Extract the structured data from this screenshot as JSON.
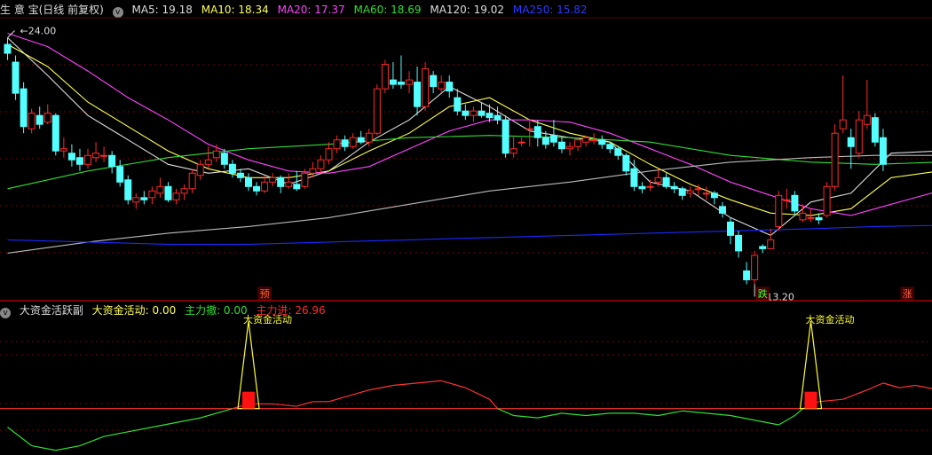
{
  "main_header": {
    "title": "生 意 宝(日线 前复权)",
    "ma5": "MA5: 19.18",
    "ma10": "MA10: 18.34",
    "ma20": "MA20: 17.37",
    "ma60": "MA60: 18.69",
    "ma120": "MA120: 19.02",
    "ma250": "MA250: 15.82"
  },
  "sub_header": {
    "title": "大资金活跃副",
    "active": "大资金活动: 0.00",
    "outflow": "主力撤: 0.00",
    "inflow": "主力进: 26.96"
  },
  "colors": {
    "up": "#ff2a2a",
    "down": "#54ffff",
    "ma5": "#dddddd",
    "ma10": "#ffff55",
    "ma20": "#ff44ff",
    "ma60": "#33dd33",
    "ma120": "#bbbbbb",
    "ma250": "#1a2aff",
    "grid": "#7a0000"
  },
  "chart_data": [
    {
      "type": "candlestick",
      "ylim": [
        12.5,
        25.2
      ],
      "price_labels": {
        "high": "24.00",
        "low": "13.20"
      },
      "candles": [
        [
          24.0,
          23.6,
          24.3,
          23.3
        ],
        [
          23.2,
          21.8,
          23.5,
          21.5
        ],
        [
          22.0,
          20.3,
          22.3,
          20.0
        ],
        [
          20.2,
          20.9,
          21.1,
          20.0
        ],
        [
          20.8,
          20.4,
          21.2,
          20.2
        ],
        [
          20.5,
          20.9,
          21.3,
          20.4
        ],
        [
          20.8,
          19.2,
          20.9,
          19.0
        ],
        [
          19.2,
          19.3,
          19.8,
          18.9
        ],
        [
          19.1,
          18.8,
          19.5,
          18.5
        ],
        [
          18.9,
          18.6,
          19.3,
          18.3
        ],
        [
          18.6,
          19.0,
          19.3,
          18.4
        ],
        [
          18.9,
          19.1,
          19.6,
          18.7
        ],
        [
          19.0,
          19.0,
          19.4,
          18.7
        ],
        [
          19.0,
          18.5,
          19.2,
          18.2
        ],
        [
          18.5,
          17.8,
          18.8,
          17.6
        ],
        [
          17.9,
          17.0,
          18.1,
          16.8
        ],
        [
          16.9,
          17.1,
          17.3,
          16.6
        ],
        [
          17.1,
          17.0,
          17.4,
          16.8
        ],
        [
          17.1,
          17.4,
          17.6,
          16.8
        ],
        [
          17.3,
          17.6,
          18.0,
          17.1
        ],
        [
          17.6,
          17.0,
          17.8,
          16.9
        ],
        [
          17.0,
          17.3,
          17.5,
          16.8
        ],
        [
          17.3,
          17.5,
          17.7,
          17.0
        ],
        [
          17.5,
          18.2,
          18.4,
          17.3
        ],
        [
          18.1,
          18.6,
          18.8,
          17.9
        ],
        [
          18.6,
          18.8,
          19.4,
          18.4
        ],
        [
          18.9,
          19.2,
          19.5,
          18.7
        ],
        [
          19.1,
          18.6,
          19.3,
          18.4
        ],
        [
          18.6,
          18.2,
          18.8,
          18.0
        ],
        [
          18.2,
          18.0,
          18.4,
          17.8
        ],
        [
          18.0,
          17.6,
          18.2,
          17.4
        ],
        [
          17.6,
          17.4,
          17.8,
          17.2
        ],
        [
          17.4,
          17.8,
          18.1,
          17.3
        ],
        [
          17.8,
          18.0,
          18.2,
          17.6
        ],
        [
          18.0,
          17.6,
          18.1,
          17.3
        ],
        [
          17.6,
          17.8,
          18.2,
          17.5
        ],
        [
          17.7,
          17.5,
          18.3,
          17.4
        ],
        [
          17.6,
          18.2,
          18.4,
          17.5
        ],
        [
          18.2,
          18.4,
          18.7,
          18.0
        ],
        [
          18.4,
          18.8,
          19.0,
          18.2
        ],
        [
          18.8,
          19.3,
          19.6,
          18.6
        ],
        [
          19.3,
          19.7,
          19.9,
          19.1
        ],
        [
          19.7,
          19.4,
          19.9,
          19.2
        ],
        [
          19.4,
          19.8,
          20.0,
          19.3
        ],
        [
          19.8,
          19.6,
          20.1,
          19.5
        ],
        [
          19.6,
          20.0,
          20.2,
          19.4
        ],
        [
          20.0,
          22.0,
          22.2,
          19.9
        ],
        [
          22.0,
          23.1,
          23.3,
          21.8
        ],
        [
          22.4,
          22.2,
          23.2,
          22.0
        ],
        [
          22.3,
          22.2,
          23.5,
          22.0
        ],
        [
          22.2,
          22.4,
          22.8,
          21.8
        ],
        [
          22.3,
          21.2,
          23.0,
          20.8
        ],
        [
          21.2,
          22.9,
          23.2,
          21.0
        ],
        [
          22.6,
          22.1,
          22.8,
          21.8
        ],
        [
          22.0,
          22.3,
          22.6,
          21.8
        ],
        [
          22.3,
          21.9,
          22.6,
          21.6
        ],
        [
          21.6,
          21.0,
          22.0,
          20.8
        ],
        [
          21.0,
          20.8,
          21.3,
          20.6
        ],
        [
          20.8,
          21.0,
          21.2,
          20.5
        ],
        [
          21.0,
          20.8,
          21.4,
          20.7
        ],
        [
          20.9,
          20.7,
          21.3,
          20.5
        ],
        [
          20.8,
          20.6,
          21.2,
          20.4
        ],
        [
          20.6,
          19.1,
          20.8,
          18.9
        ],
        [
          19.1,
          19.3,
          19.9,
          18.9
        ],
        [
          19.6,
          19.6,
          19.8,
          19.4
        ],
        [
          20.2,
          20.2,
          20.6,
          19.4
        ],
        [
          20.3,
          19.8,
          20.6,
          19.4
        ],
        [
          19.8,
          19.5,
          20.1,
          19.3
        ],
        [
          19.9,
          19.6,
          20.6,
          19.4
        ],
        [
          19.6,
          19.3,
          19.8,
          19.1
        ],
        [
          19.3,
          19.4,
          19.6,
          19.0
        ],
        [
          19.4,
          19.7,
          19.8,
          19.2
        ],
        [
          19.6,
          19.8,
          19.9,
          19.4
        ],
        [
          19.7,
          19.7,
          20.0,
          19.5
        ],
        [
          19.7,
          19.5,
          19.9,
          19.3
        ],
        [
          19.5,
          19.3,
          19.6,
          19.1
        ],
        [
          19.3,
          19.0,
          19.4,
          18.8
        ],
        [
          19.0,
          18.3,
          19.1,
          18.1
        ],
        [
          18.4,
          17.6,
          18.8,
          17.4
        ],
        [
          17.6,
          17.5,
          17.8,
          17.3
        ],
        [
          17.6,
          17.6,
          17.9,
          17.4
        ],
        [
          17.8,
          18.0,
          18.4,
          17.6
        ],
        [
          18.0,
          17.6,
          18.2,
          17.5
        ],
        [
          17.6,
          17.5,
          17.8,
          17.3
        ],
        [
          17.5,
          17.2,
          17.6,
          17.0
        ],
        [
          17.3,
          17.4,
          17.6,
          17.1
        ],
        [
          17.5,
          17.5,
          17.7,
          17.2
        ],
        [
          17.3,
          17.3,
          17.6,
          17.0
        ],
        [
          17.3,
          17.1,
          17.4,
          16.8
        ],
        [
          16.7,
          16.4,
          16.9,
          16.2
        ],
        [
          16.0,
          15.4,
          16.2,
          15.0
        ],
        [
          15.4,
          14.7,
          15.6,
          14.4
        ],
        [
          13.8,
          13.4,
          14.2,
          13.2
        ],
        [
          13.4,
          14.5,
          14.7,
          13.2
        ],
        [
          14.9,
          14.8,
          15.0,
          14.6
        ],
        [
          14.8,
          15.2,
          15.7,
          14.8
        ],
        [
          15.8,
          17.2,
          17.4,
          15.6
        ],
        [
          17.0,
          17.0,
          17.5,
          16.6
        ],
        [
          17.2,
          16.5,
          17.4,
          16.3
        ],
        [
          16.1,
          16.4,
          16.8,
          16.0
        ],
        [
          16.2,
          16.2,
          16.6,
          16.0
        ],
        [
          16.2,
          16.1,
          16.4,
          15.9
        ],
        [
          16.3,
          17.6,
          17.8,
          16.2
        ],
        [
          17.6,
          20.0,
          20.4,
          17.4
        ],
        [
          20.2,
          20.6,
          22.6,
          20.0
        ],
        [
          19.8,
          19.4,
          20.2,
          18.4
        ],
        [
          19.1,
          20.6,
          21.0,
          18.9
        ],
        [
          20.4,
          20.8,
          22.4,
          20.2
        ],
        [
          20.7,
          19.6,
          20.9,
          19.4
        ],
        [
          19.8,
          18.6,
          20.2,
          18.3
        ]
      ],
      "ma_series": {
        "MA5": [
          [
            0,
            24.3
          ],
          [
            5,
            22.6
          ],
          [
            10,
            20.8
          ],
          [
            15,
            19.7
          ],
          [
            20,
            18.6
          ],
          [
            25,
            18.2
          ],
          [
            30,
            18.4
          ],
          [
            35,
            17.7
          ],
          [
            40,
            18.3
          ],
          [
            45,
            19.6
          ],
          [
            50,
            20.6
          ],
          [
            55,
            22.1
          ],
          [
            60,
            21.2
          ],
          [
            65,
            20.1
          ],
          [
            70,
            19.8
          ],
          [
            75,
            19.6
          ],
          [
            80,
            17.8
          ],
          [
            85,
            17.4
          ],
          [
            90,
            16.2
          ],
          [
            95,
            15.4
          ],
          [
            100,
            16.9
          ],
          [
            105,
            17.3
          ],
          [
            110,
            19.1
          ],
          [
            116,
            19.2
          ]
        ],
        "MA10": [
          [
            0,
            24.0
          ],
          [
            5,
            23.0
          ],
          [
            10,
            21.4
          ],
          [
            15,
            20.3
          ],
          [
            20,
            19.2
          ],
          [
            25,
            18.4
          ],
          [
            30,
            18.0
          ],
          [
            35,
            18.0
          ],
          [
            40,
            18.3
          ],
          [
            45,
            19.2
          ],
          [
            50,
            20.0
          ],
          [
            55,
            21.2
          ],
          [
            60,
            21.6
          ],
          [
            65,
            20.6
          ],
          [
            70,
            20.0
          ],
          [
            75,
            19.6
          ],
          [
            80,
            18.6
          ],
          [
            85,
            17.7
          ],
          [
            90,
            17.0
          ],
          [
            95,
            16.4
          ],
          [
            100,
            16.3
          ],
          [
            105,
            16.6
          ],
          [
            110,
            18.0
          ],
          [
            116,
            18.3
          ]
        ],
        "MA20": [
          [
            0,
            24.5
          ],
          [
            5,
            23.9
          ],
          [
            10,
            22.8
          ],
          [
            15,
            21.6
          ],
          [
            20,
            20.6
          ],
          [
            25,
            19.5
          ],
          [
            30,
            18.8
          ],
          [
            35,
            18.3
          ],
          [
            40,
            18.2
          ],
          [
            45,
            18.5
          ],
          [
            50,
            19.3
          ],
          [
            55,
            20.1
          ],
          [
            60,
            20.6
          ],
          [
            65,
            20.6
          ],
          [
            70,
            20.5
          ],
          [
            75,
            20.0
          ],
          [
            80,
            19.3
          ],
          [
            85,
            18.6
          ],
          [
            90,
            17.8
          ],
          [
            95,
            17.2
          ],
          [
            100,
            16.6
          ],
          [
            105,
            16.3
          ],
          [
            110,
            16.8
          ],
          [
            116,
            17.4
          ]
        ],
        "MA60": [
          [
            0,
            17.5
          ],
          [
            10,
            18.3
          ],
          [
            20,
            18.9
          ],
          [
            30,
            19.3
          ],
          [
            40,
            19.5
          ],
          [
            50,
            19.8
          ],
          [
            60,
            19.9
          ],
          [
            70,
            19.8
          ],
          [
            80,
            19.6
          ],
          [
            90,
            19.0
          ],
          [
            100,
            18.7
          ],
          [
            108,
            18.6
          ],
          [
            116,
            18.7
          ]
        ],
        "MA120": [
          [
            0,
            14.6
          ],
          [
            10,
            15.1
          ],
          [
            20,
            15.5
          ],
          [
            30,
            15.8
          ],
          [
            40,
            16.2
          ],
          [
            50,
            16.8
          ],
          [
            60,
            17.4
          ],
          [
            70,
            17.8
          ],
          [
            80,
            18.3
          ],
          [
            90,
            18.7
          ],
          [
            100,
            18.9
          ],
          [
            108,
            19.0
          ],
          [
            116,
            19.0
          ]
        ],
        "MA250": [
          [
            0,
            15.2
          ],
          [
            10,
            15.1
          ],
          [
            20,
            15.0
          ],
          [
            30,
            15.0
          ],
          [
            40,
            15.1
          ],
          [
            50,
            15.2
          ],
          [
            60,
            15.3
          ],
          [
            70,
            15.4
          ],
          [
            80,
            15.5
          ],
          [
            90,
            15.6
          ],
          [
            100,
            15.7
          ],
          [
            108,
            15.8
          ],
          [
            116,
            15.85
          ]
        ]
      },
      "markers": [
        {
          "label": "预",
          "index": 32,
          "color": "#ff6622"
        },
        {
          "label": "跌",
          "index": 94,
          "color": "#44ff44"
        },
        {
          "label": "涨",
          "index": 112,
          "color": "#ff6644"
        }
      ]
    },
    {
      "type": "line",
      "title": "大资金活跃副",
      "ylim": [
        -20,
        40
      ],
      "zero_level": 0,
      "main_force": [
        [
          0,
          -8
        ],
        [
          3,
          -16
        ],
        [
          6,
          -18
        ],
        [
          9,
          -16
        ],
        [
          12,
          -12
        ],
        [
          15,
          -10
        ],
        [
          18,
          -8
        ],
        [
          21,
          -6
        ],
        [
          24,
          -4
        ],
        [
          27,
          -1
        ],
        [
          28,
          0
        ],
        [
          30,
          2
        ],
        [
          33,
          2
        ],
        [
          36,
          1
        ],
        [
          38,
          3
        ],
        [
          40,
          3
        ],
        [
          42,
          5
        ],
        [
          45,
          8
        ],
        [
          48,
          10
        ],
        [
          51,
          11
        ],
        [
          54,
          12
        ],
        [
          57,
          9
        ],
        [
          60,
          4
        ],
        [
          61,
          0
        ],
        [
          63,
          -3
        ],
        [
          66,
          -4
        ],
        [
          69,
          -2
        ],
        [
          72,
          -3
        ],
        [
          75,
          -2
        ],
        [
          78,
          -2
        ],
        [
          81,
          -3
        ],
        [
          84,
          -1
        ],
        [
          87,
          -2
        ],
        [
          90,
          -3
        ],
        [
          93,
          -5
        ],
        [
          96,
          -7
        ],
        [
          98,
          -3
        ],
        [
          99,
          0
        ],
        [
          101,
          3
        ],
        [
          104,
          4
        ],
        [
          107,
          8
        ],
        [
          109,
          11
        ],
        [
          111,
          9
        ],
        [
          113,
          10
        ],
        [
          116,
          8
        ]
      ],
      "big_money_events": [
        {
          "index": 30,
          "label": "大资金活动"
        },
        {
          "index": 100,
          "label": "大资金活动"
        }
      ]
    }
  ]
}
